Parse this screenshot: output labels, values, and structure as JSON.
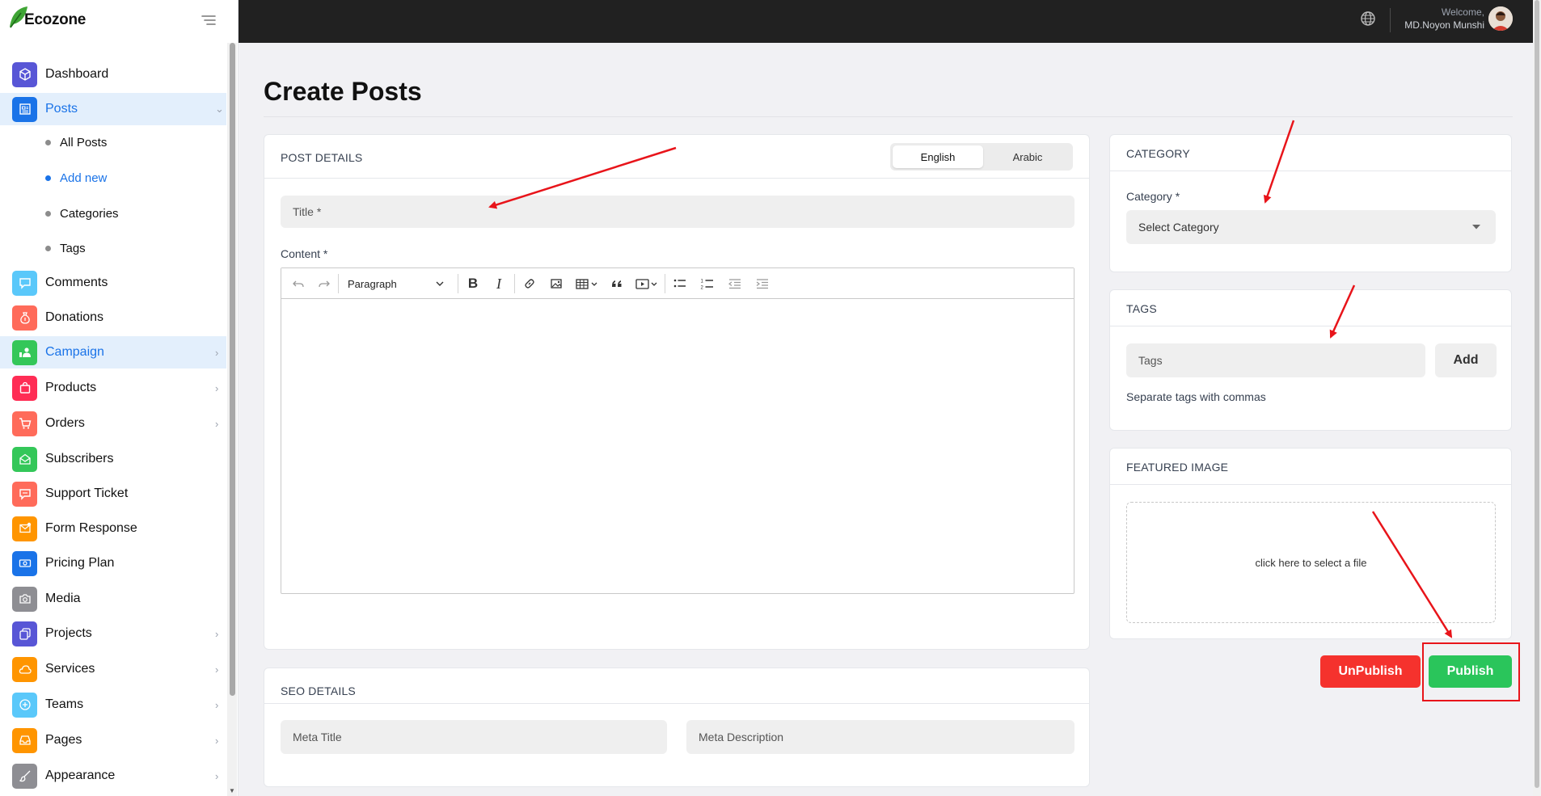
{
  "brand": {
    "name": "Ecozone"
  },
  "header": {
    "welcome": "Welcome,",
    "user_name": "MD.Noyon Munshi"
  },
  "sidebar": {
    "items": [
      {
        "label": "Dashboard",
        "icon": "cube-icon",
        "color": "#5856d6"
      },
      {
        "label": "Posts",
        "icon": "newspaper-icon",
        "color": "#1a73e8"
      },
      {
        "label": "Comments",
        "icon": "chat-bubble-icon",
        "color": "#5ac8fa"
      },
      {
        "label": "Donations",
        "icon": "donation-bag-icon",
        "color": "#ff6b5a"
      },
      {
        "label": "Campaign",
        "icon": "campaign-person-icon",
        "color": "#34c759"
      },
      {
        "label": "Products",
        "icon": "shopping-bag-icon",
        "color": "#ff2d55"
      },
      {
        "label": "Orders",
        "icon": "cart-icon",
        "color": "#ff6b5a"
      },
      {
        "label": "Subscribers",
        "icon": "envelope-open-icon",
        "color": "#34c759"
      },
      {
        "label": "Support Ticket",
        "icon": "support-chat-icon",
        "color": "#ff6b5a"
      },
      {
        "label": "Form Response",
        "icon": "mail-check-icon",
        "color": "#ff9500"
      },
      {
        "label": "Pricing Plan",
        "icon": "money-icon",
        "color": "#1a73e8"
      },
      {
        "label": "Media",
        "icon": "camera-icon",
        "color": "#8e8e93"
      },
      {
        "label": "Projects",
        "icon": "copy-icon",
        "color": "#5856d6"
      },
      {
        "label": "Services",
        "icon": "cloud-icon",
        "color": "#ff9500"
      },
      {
        "label": "Teams",
        "icon": "plus-circle-icon",
        "color": "#5ac8fa"
      },
      {
        "label": "Pages",
        "icon": "inbox-icon",
        "color": "#ff9500"
      },
      {
        "label": "Appearance",
        "icon": "brush-icon",
        "color": "#8e8e93"
      }
    ],
    "posts_sub": [
      {
        "label": "All Posts"
      },
      {
        "label": "Add new"
      },
      {
        "label": "Categories"
      },
      {
        "label": "Tags"
      }
    ]
  },
  "main": {
    "page_title": "Create Posts",
    "post_details": {
      "heading": "POST DETAILS",
      "lang_english": "English",
      "lang_arabic": "Arabic",
      "title_placeholder": "Title *",
      "content_label": "Content *",
      "paragraph_select": "Paragraph"
    },
    "seo": {
      "heading": "SEO DETAILS",
      "meta_title_placeholder": "Meta Title",
      "meta_description_placeholder": "Meta Description"
    },
    "category": {
      "heading": "CATEGORY",
      "label": "Category *",
      "select_value": "Select Category"
    },
    "tags": {
      "heading": "TAGS",
      "placeholder": "Tags",
      "add_label": "Add",
      "hint": "Separate tags with commas"
    },
    "featured_image": {
      "heading": "FEATURED IMAGE",
      "dropzone_text": "click here to select a file"
    },
    "actions": {
      "unpublish_label": "UnPublish",
      "publish_label": "Publish"
    }
  },
  "colors": {
    "accent": "#1a73e8",
    "publish": "#2ac55b",
    "unpublish": "#f5322d",
    "annotation": "#e8141a"
  }
}
